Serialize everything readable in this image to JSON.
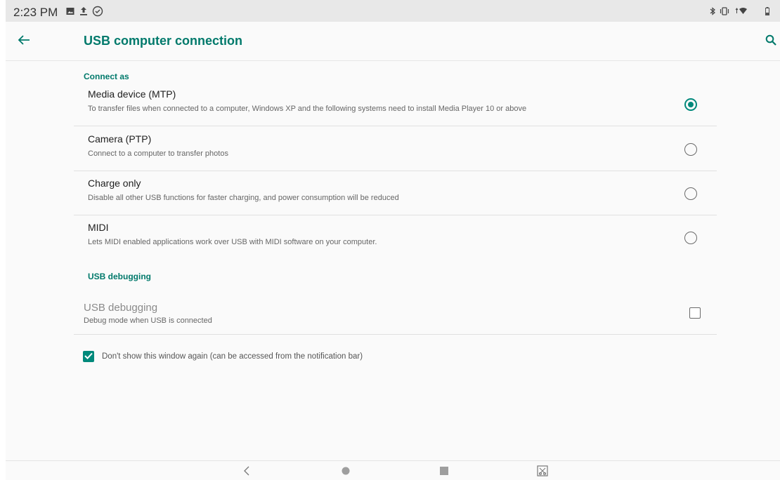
{
  "status_bar": {
    "time": "2:23 PM",
    "left_icons": [
      "image-notification-icon",
      "upload-icon",
      "sync-icon"
    ],
    "right_icons": [
      "bluetooth-icon",
      "vibrate-icon",
      "wifi-icon",
      "battery-icon"
    ]
  },
  "app_bar": {
    "title": "USB computer connection",
    "back_icon": "arrow-left-icon",
    "search_icon": "search-icon"
  },
  "connect_as": {
    "header": "Connect as",
    "options": [
      {
        "title": "Media device (MTP)",
        "desc": "To transfer files when connected to a computer, Windows XP and the following systems need to install Media Player 10 or above",
        "selected": true
      },
      {
        "title": "Camera (PTP)",
        "desc": "Connect to a computer to transfer photos",
        "selected": false
      },
      {
        "title": "Charge only",
        "desc": "Disable all other USB functions for faster charging, and power consumption will be reduced",
        "selected": false
      },
      {
        "title": "MIDI",
        "desc": "Lets MIDI enabled applications work over USB with MIDI software on your computer.",
        "selected": false
      }
    ]
  },
  "usb_debugging": {
    "header": "USB debugging",
    "title": "USB debugging",
    "desc": "Debug mode when USB is connected",
    "checked": false
  },
  "dont_show": {
    "label": "Don't show this window again (can be accessed from the notification bar)",
    "checked": true
  },
  "nav_bar": {
    "buttons": [
      "back-nav-icon",
      "home-nav-icon",
      "recents-nav-icon",
      "screenshot-nav-icon"
    ]
  },
  "colors": {
    "accent": "#00796b",
    "radio_selected": "#00897b",
    "background": "#fafafa",
    "status_bar": "#e8e8e8"
  }
}
